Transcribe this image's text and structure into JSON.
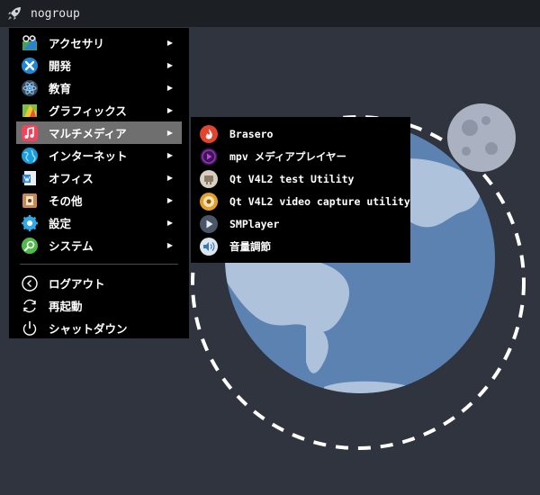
{
  "topbar": {
    "group_name": "nogroup"
  },
  "menu": {
    "items": [
      {
        "label": "アクセサリ",
        "icon": "accessories-icon"
      },
      {
        "label": "開発",
        "icon": "development-icon"
      },
      {
        "label": "教育",
        "icon": "education-icon"
      },
      {
        "label": "グラフィックス",
        "icon": "graphics-icon"
      },
      {
        "label": "マルチメディア",
        "icon": "multimedia-icon",
        "active": true
      },
      {
        "label": "インターネット",
        "icon": "internet-icon"
      },
      {
        "label": "オフィス",
        "icon": "office-icon"
      },
      {
        "label": "その他",
        "icon": "other-icon"
      },
      {
        "label": "設定",
        "icon": "settings-icon"
      },
      {
        "label": "システム",
        "icon": "system-icon"
      }
    ],
    "session": [
      {
        "label": "ログアウト",
        "icon": "logout-icon"
      },
      {
        "label": "再起動",
        "icon": "restart-icon"
      },
      {
        "label": "シャットダウン",
        "icon": "shutdown-icon"
      }
    ],
    "arrow": "▶"
  },
  "submenu": {
    "items": [
      {
        "label": "Brasero",
        "icon": "brasero-icon"
      },
      {
        "label": "mpv メディアプレイヤー",
        "icon": "mpv-icon"
      },
      {
        "label": "Qt V4L2 test Utility",
        "icon": "qv4l2-icon"
      },
      {
        "label": "Qt V4L2 video capture utility",
        "icon": "qvidcap-icon"
      },
      {
        "label": "SMPlayer",
        "icon": "smplayer-icon"
      },
      {
        "label": "音量調節",
        "icon": "volume-icon"
      }
    ]
  },
  "colors": {
    "desktop": "#2f343f",
    "panel": "#1c1f24",
    "menu_bg": "#000000",
    "active_item": "#6f6f6f",
    "earth": "#5b82b1",
    "land": "#aec2dc",
    "moon": "#aab1c0"
  }
}
